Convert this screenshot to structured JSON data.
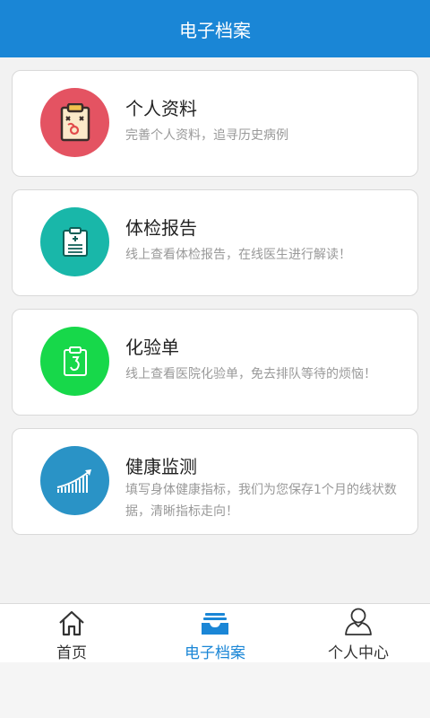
{
  "header": {
    "title": "电子档案"
  },
  "colors": {
    "header_bg": "#1a86d6",
    "personal_info": "#e45362",
    "exam_report": "#19b7a9",
    "lab_sheet": "#17d84a",
    "health_monitor": "#2a93c6",
    "active_tab": "#1a86d6"
  },
  "cards": [
    {
      "title": "个人资料",
      "desc": "完善个人资料，追寻历史病例",
      "icon": "clipboard-xo-icon"
    },
    {
      "title": "体检报告",
      "desc": "线上查看体检报告，在线医生进行解读！",
      "icon": "medical-report-icon"
    },
    {
      "title": "化验单",
      "desc": "线上查看医院化验单，免去排队等待的烦恼！",
      "icon": "lab-clipboard-icon"
    },
    {
      "title": "健康监测",
      "desc": "填写身体健康指标，我们为您保存1个月的线状数据，清晰指标走向！",
      "icon": "rising-chart-icon"
    }
  ],
  "tabs": [
    {
      "label": "首页",
      "icon": "home-icon"
    },
    {
      "label": "电子档案",
      "icon": "inbox-tray-icon",
      "active": true
    },
    {
      "label": "个人中心",
      "icon": "person-icon"
    }
  ]
}
